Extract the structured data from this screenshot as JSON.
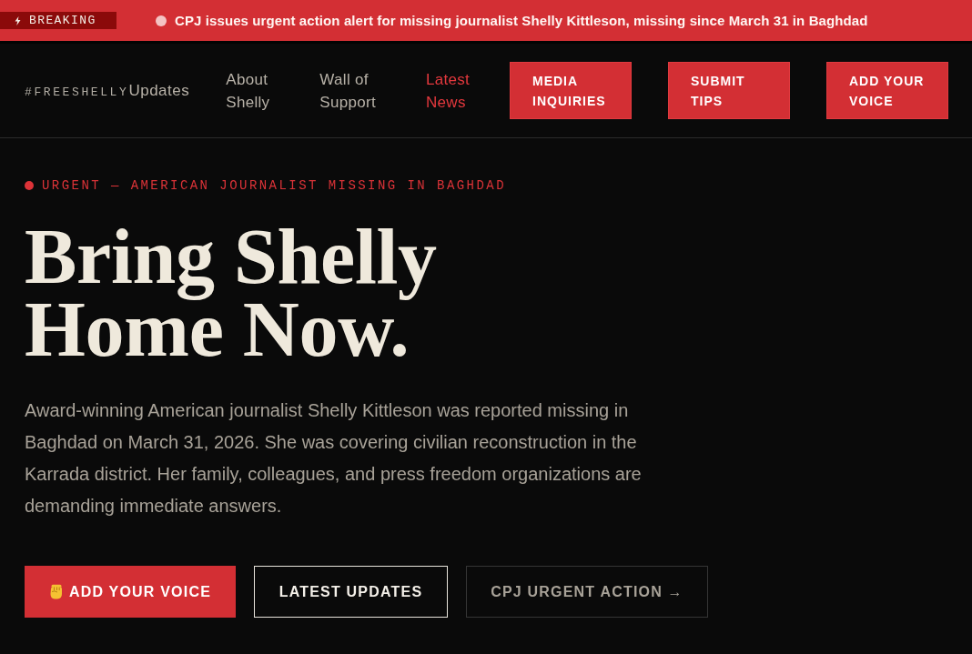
{
  "ticker": {
    "badge": "BREAKING",
    "headline": "CPJ issues urgent action alert for missing journalist Shelly Kittleson, missing since March 31 in Baghdad"
  },
  "header": {
    "logo": {
      "tag": "#FREESHELLY",
      "suffix": "Updates"
    },
    "nav_links": [
      {
        "label": "About Shelly",
        "selected": false
      },
      {
        "label": "Wall of Support",
        "selected": false
      },
      {
        "label": "Latest News",
        "selected": true
      }
    ],
    "action_buttons": [
      "MEDIA INQUIRIES",
      "SUBMIT TIPS",
      "ADD YOUR VOICE"
    ]
  },
  "hero": {
    "eyebrow": "URGENT — AMERICAN JOURNALIST MISSING IN BAGHDAD",
    "title": "Bring Shelly Home Now.",
    "body": "Award-winning American journalist Shelly Kittleson was reported missing in Baghdad on March 31, 2026. She was covering civilian reconstruction in the Karrada district. Her family, colleagues, and press freedom organizations are demanding immediate answers.",
    "buttons": [
      {
        "label": "ADD YOUR VOICE",
        "kind": "primary"
      },
      {
        "label": "LATEST UPDATES",
        "kind": "outline"
      },
      {
        "label": "CPJ URGENT ACTION →",
        "kind": "ghost"
      }
    ]
  }
}
